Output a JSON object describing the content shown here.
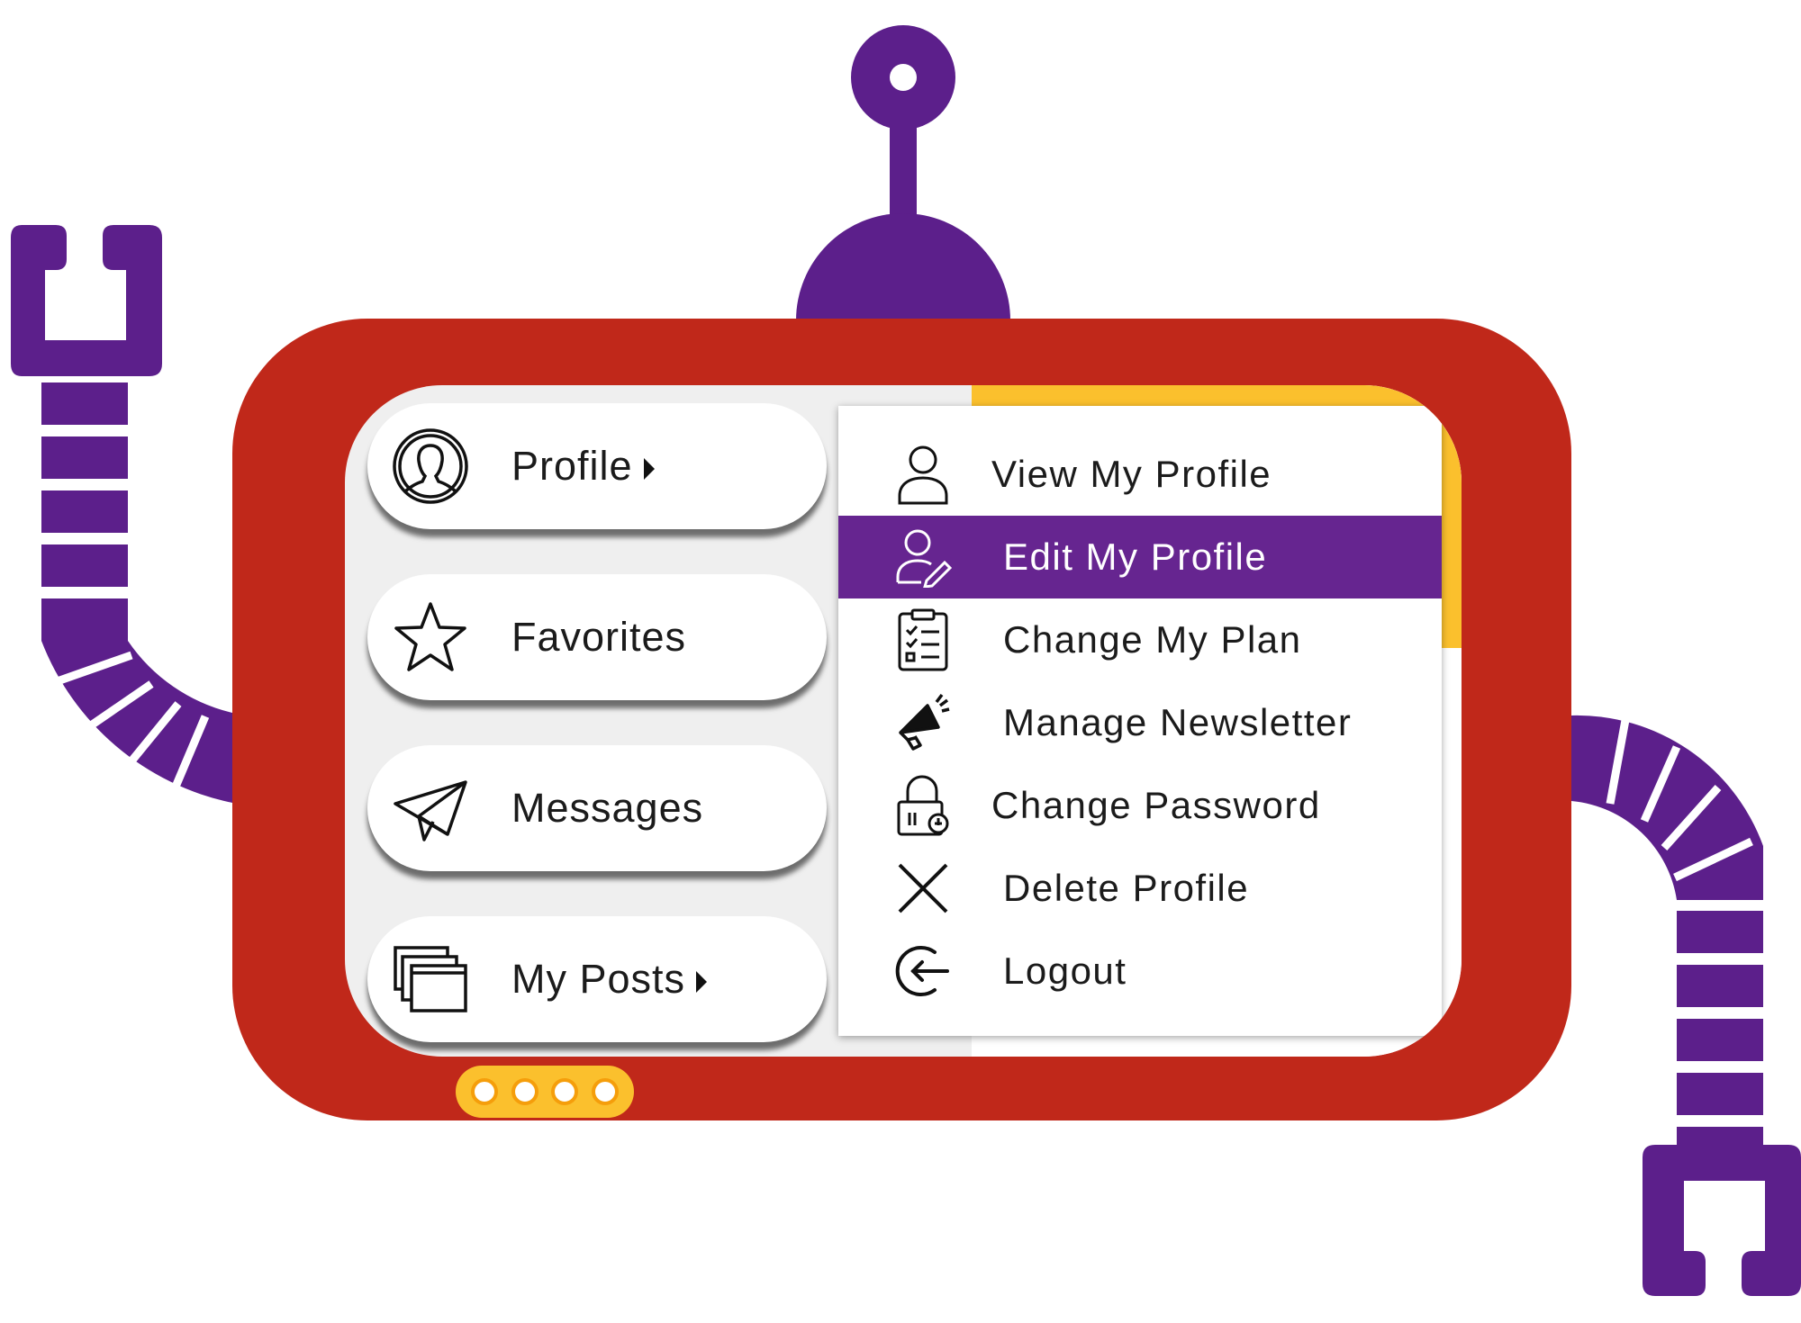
{
  "colors": {
    "frame": "#c0281a",
    "accent": "#662590",
    "robot": "#5c1f8b",
    "highlight": "#fbc02d"
  },
  "menu": {
    "items": [
      {
        "label": "Profile",
        "icon": "user-circle-icon",
        "has_submenu": true
      },
      {
        "label": "Favorites",
        "icon": "star-icon",
        "has_submenu": false
      },
      {
        "label": "Messages",
        "icon": "paper-plane-icon",
        "has_submenu": false
      },
      {
        "label": "My Posts",
        "icon": "stacked-windows-icon",
        "has_submenu": true
      }
    ]
  },
  "submenu": {
    "items": [
      {
        "label": "View My Profile",
        "icon": "user-icon"
      },
      {
        "label": "Edit My Profile",
        "icon": "user-edit-icon",
        "active": true
      },
      {
        "label": "Change My Plan",
        "icon": "clipboard-checklist-icon"
      },
      {
        "label": "Manage Newsletter",
        "icon": "megaphone-icon"
      },
      {
        "label": "Change Password",
        "icon": "padlock-icon"
      },
      {
        "label": "Delete Profile",
        "icon": "close-icon"
      },
      {
        "label": "Logout",
        "icon": "logout-icon"
      }
    ]
  },
  "status_lights": {
    "count": 4
  }
}
